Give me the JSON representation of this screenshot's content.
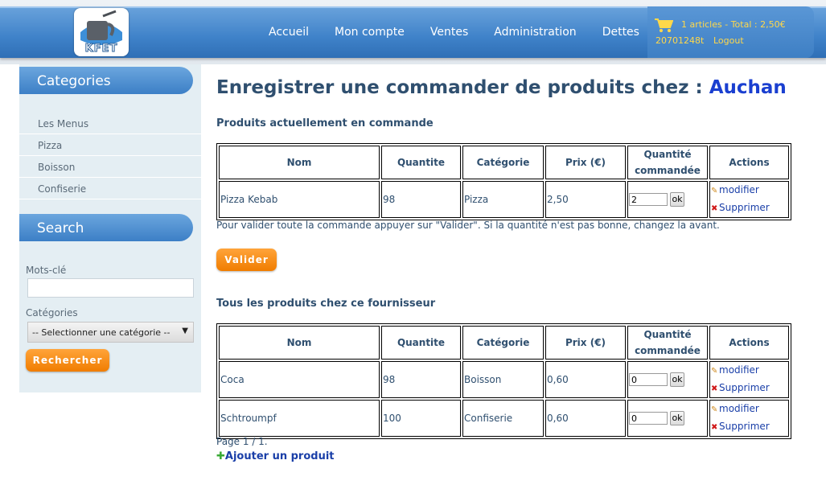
{
  "header": {
    "logo_text": "KFET",
    "nav": [
      "Accueil",
      "Mon compte",
      "Ventes",
      "Administration",
      "Dettes"
    ],
    "cart": {
      "summary": "1 articles - Total : 2,50€",
      "user": "20701248t",
      "logout": "Logout"
    }
  },
  "sidebar": {
    "categories_title": "Categories",
    "categories": [
      "Les Menus",
      "Pizza",
      "Boisson",
      "Confiserie"
    ],
    "search_title": "Search",
    "keywords_label": "Mots-clé",
    "keywords_value": "",
    "category_label": "Catégories",
    "category_selected": "-- Selectionner une catégorie --",
    "search_button": "Rechercher"
  },
  "main": {
    "title_prefix": "Enregistrer une commander de produits chez : ",
    "supplier": "Auchan",
    "current_title": "Produits actuellement en commande",
    "columns": [
      "Nom",
      "Quantite",
      "Catégorie",
      "Prix (€)",
      "Quantité commandée",
      "Actions"
    ],
    "current_rows": [
      {
        "name": "Pizza Kebab",
        "quantity": "98",
        "category": "Pizza",
        "price": "2,50",
        "ordered": "2"
      }
    ],
    "note": "Pour valider toute la commande appuyer sur \"Valider\". Si la quantité n'est pas bonne, changez la avant.",
    "validate_button": "Valider",
    "all_title": "Tous les produits chez ce fournisseur",
    "all_rows": [
      {
        "name": "Coca",
        "quantity": "98",
        "category": "Boisson",
        "price": "0,60",
        "ordered": "0"
      },
      {
        "name": "Schtroumpf",
        "quantity": "100",
        "category": "Confiserie",
        "price": "0,60",
        "ordered": "0"
      }
    ],
    "ok_label": "ok",
    "modify_label": "modifier",
    "delete_label": "Supprimer",
    "page_info": "Page 1 / 1.",
    "add_product": "Ajouter un produit"
  }
}
